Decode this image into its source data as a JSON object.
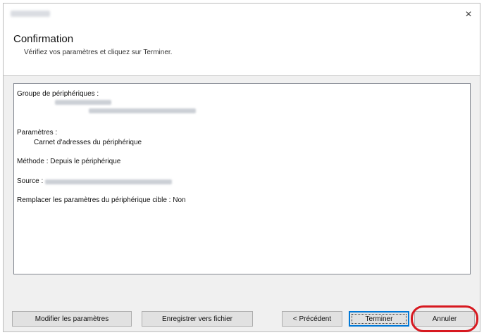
{
  "window": {
    "close_icon": "×"
  },
  "header": {
    "title": "Confirmation",
    "subtitle": "Vérifiez vos paramètres et cliquez sur Terminer."
  },
  "summary": {
    "device_group_label": "Groupe de périphériques :",
    "settings_label": "Paramètres :",
    "settings_value": "Carnet d'adresses du périphérique",
    "method": "Méthode : Depuis le périphérique",
    "source_label": "Source :",
    "replace": "Remplacer les paramètres du périphérique cible : Non"
  },
  "buttons": {
    "modify": "Modifier les paramètres",
    "save": "Enregistrer vers fichier",
    "previous": "< Précédent",
    "finish": "Terminer",
    "cancel": "Annuler"
  },
  "highlight_color": "#d71920"
}
